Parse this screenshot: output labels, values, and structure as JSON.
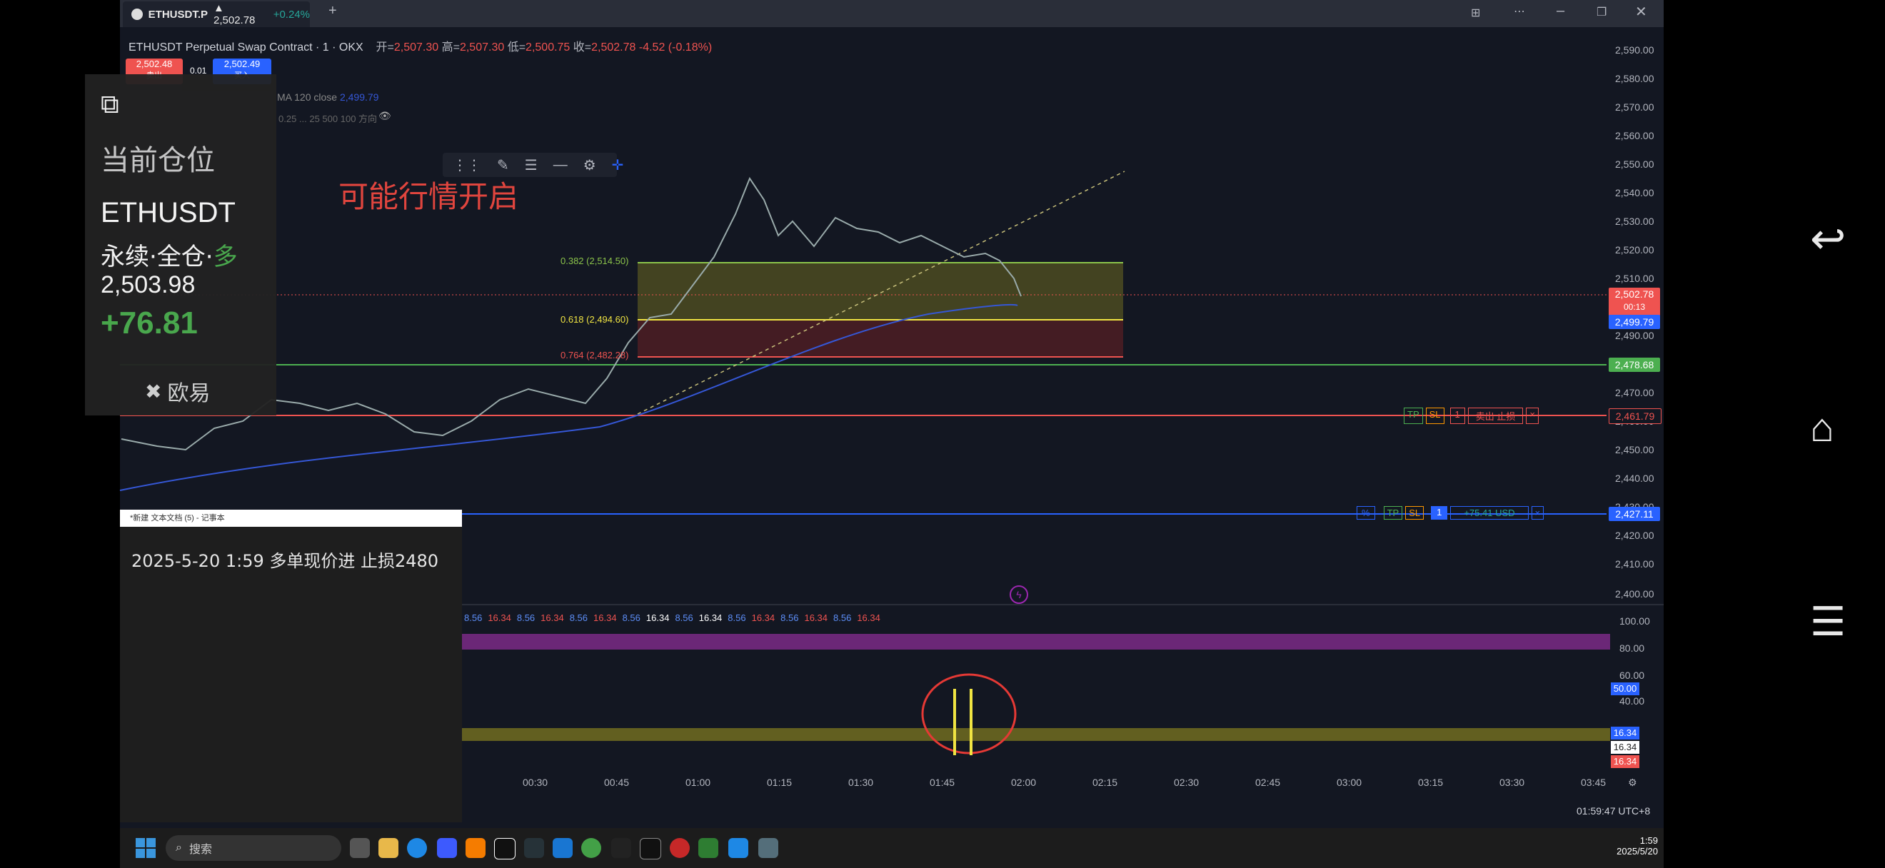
{
  "window": {
    "tab_symbol": "ETHUSDT.P",
    "tab_price": "▲ 2,502.78",
    "tab_change": "+0.24%",
    "new_tab": "+"
  },
  "chart_header": {
    "title": "ETHUSDT Perpetual Swap Contract · 1 · OKX",
    "ohlc": {
      "o_label": "开=",
      "o": "2,507.30",
      "h_label": "高=",
      "h": "2,507.30",
      "l_label": "低=",
      "l": "2,500.75",
      "c_label": "收=",
      "c": "2,502.78",
      "chg": "-4.52 (-0.18%)"
    },
    "sell_price": "2,502.48",
    "sell_label": "卖出",
    "spread": "0.01",
    "buy_price": "2,502.49",
    "buy_label": "买入",
    "ma_label": "MA 120 close",
    "ma_value": "2,499.79",
    "indicator_label": "0.25 ... 25 500 100 方向"
  },
  "annotation": {
    "text": "可能行情开启",
    "color": "#e0453e"
  },
  "fib": [
    {
      "label": "0.382 (2,514.50)",
      "color": "#8bc34a"
    },
    {
      "label": "0.618 (2,494.60)",
      "color": "#f0e442"
    },
    {
      "label": "0.764 (2,482.28)",
      "color": "#ef5350"
    }
  ],
  "price_axis": [
    "2,590.00",
    "2,580.00",
    "2,570.00",
    "2,560.00",
    "2,550.00",
    "2,540.00",
    "2,530.00",
    "2,520.00",
    "2,510.00",
    "2,500.00",
    "2,490.00",
    "2,470.00",
    "2,460.00",
    "2,450.00",
    "2,440.00",
    "2,430.00",
    "2,420.00",
    "2,410.00",
    "2,400.00"
  ],
  "price_tags": {
    "last": "2,502.78",
    "countdown": "00:13",
    "ma": "2,499.79",
    "green": "2,478.68",
    "sl": "2,461.79",
    "entry": "2,427.11"
  },
  "orders": {
    "sl_tp": "TP",
    "sl_sl": "SL",
    "sl_qty": "1",
    "sl_text": "卖出 止损",
    "pos_pct": "%",
    "pos_tp": "TP",
    "pos_sl": "SL",
    "pos_qty": "1",
    "pos_pnl": "+75.41 USD",
    "close": "×"
  },
  "osc": {
    "values_row": [
      "8.56",
      "16.34",
      "8.56",
      "16.34",
      "8.56",
      "16.34",
      "8.56",
      "16.34",
      "8.56",
      "16.34",
      "8.56",
      "16.34",
      "8.56",
      "16.34",
      "8.56",
      "16.34"
    ],
    "axis": [
      "100.00",
      "80.00",
      "60.00",
      "40.00"
    ],
    "tag50": "50.00",
    "tags": [
      "16.34",
      "16.34",
      "16.34"
    ]
  },
  "time_axis": [
    "00:30",
    "00:45",
    "01:00",
    "01:15",
    "01:30",
    "01:45",
    "02:00",
    "02:15",
    "02:30",
    "02:45",
    "03:00",
    "03:15",
    "03:30",
    "03:45"
  ],
  "clock": "01:59:47 UTC+8",
  "card": {
    "title": "当前仓位",
    "symbol": "ETHUSDT",
    "mode_prefix": "永续·全仓·",
    "mode_side": "多",
    "avg_price": "2,503.98",
    "pnl": "+76.81",
    "exchange": "欧易"
  },
  "notepad": {
    "title": "*新建 文本文档 (5) - 记事本",
    "text": "2025-5-20 1:59 多单现价进 止损2480"
  },
  "taskbar": {
    "search": "搜索",
    "time": "1:59",
    "date": "2025/5/20"
  }
}
